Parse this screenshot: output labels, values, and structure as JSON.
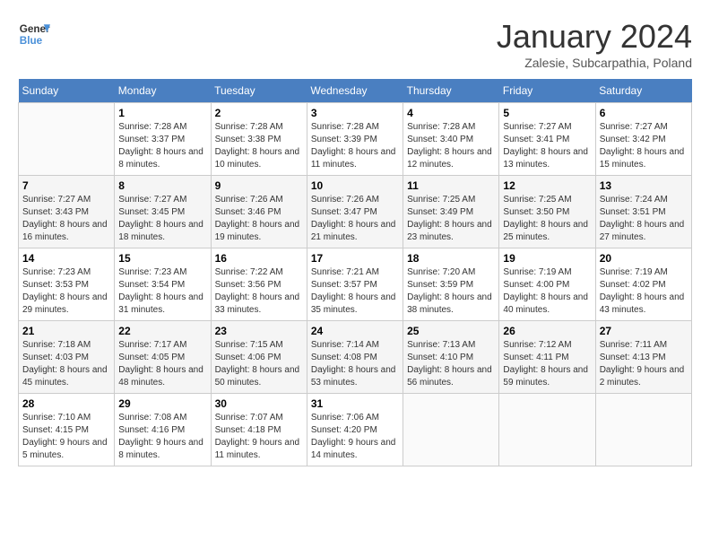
{
  "header": {
    "logo_line1": "General",
    "logo_line2": "Blue",
    "month": "January 2024",
    "location": "Zalesie, Subcarpathia, Poland"
  },
  "weekdays": [
    "Sunday",
    "Monday",
    "Tuesday",
    "Wednesday",
    "Thursday",
    "Friday",
    "Saturday"
  ],
  "weeks": [
    [
      {
        "num": "",
        "sunrise": "",
        "sunset": "",
        "daylight": ""
      },
      {
        "num": "1",
        "sunrise": "Sunrise: 7:28 AM",
        "sunset": "Sunset: 3:37 PM",
        "daylight": "Daylight: 8 hours and 8 minutes."
      },
      {
        "num": "2",
        "sunrise": "Sunrise: 7:28 AM",
        "sunset": "Sunset: 3:38 PM",
        "daylight": "Daylight: 8 hours and 10 minutes."
      },
      {
        "num": "3",
        "sunrise": "Sunrise: 7:28 AM",
        "sunset": "Sunset: 3:39 PM",
        "daylight": "Daylight: 8 hours and 11 minutes."
      },
      {
        "num": "4",
        "sunrise": "Sunrise: 7:28 AM",
        "sunset": "Sunset: 3:40 PM",
        "daylight": "Daylight: 8 hours and 12 minutes."
      },
      {
        "num": "5",
        "sunrise": "Sunrise: 7:27 AM",
        "sunset": "Sunset: 3:41 PM",
        "daylight": "Daylight: 8 hours and 13 minutes."
      },
      {
        "num": "6",
        "sunrise": "Sunrise: 7:27 AM",
        "sunset": "Sunset: 3:42 PM",
        "daylight": "Daylight: 8 hours and 15 minutes."
      }
    ],
    [
      {
        "num": "7",
        "sunrise": "Sunrise: 7:27 AM",
        "sunset": "Sunset: 3:43 PM",
        "daylight": "Daylight: 8 hours and 16 minutes."
      },
      {
        "num": "8",
        "sunrise": "Sunrise: 7:27 AM",
        "sunset": "Sunset: 3:45 PM",
        "daylight": "Daylight: 8 hours and 18 minutes."
      },
      {
        "num": "9",
        "sunrise": "Sunrise: 7:26 AM",
        "sunset": "Sunset: 3:46 PM",
        "daylight": "Daylight: 8 hours and 19 minutes."
      },
      {
        "num": "10",
        "sunrise": "Sunrise: 7:26 AM",
        "sunset": "Sunset: 3:47 PM",
        "daylight": "Daylight: 8 hours and 21 minutes."
      },
      {
        "num": "11",
        "sunrise": "Sunrise: 7:25 AM",
        "sunset": "Sunset: 3:49 PM",
        "daylight": "Daylight: 8 hours and 23 minutes."
      },
      {
        "num": "12",
        "sunrise": "Sunrise: 7:25 AM",
        "sunset": "Sunset: 3:50 PM",
        "daylight": "Daylight: 8 hours and 25 minutes."
      },
      {
        "num": "13",
        "sunrise": "Sunrise: 7:24 AM",
        "sunset": "Sunset: 3:51 PM",
        "daylight": "Daylight: 8 hours and 27 minutes."
      }
    ],
    [
      {
        "num": "14",
        "sunrise": "Sunrise: 7:23 AM",
        "sunset": "Sunset: 3:53 PM",
        "daylight": "Daylight: 8 hours and 29 minutes."
      },
      {
        "num": "15",
        "sunrise": "Sunrise: 7:23 AM",
        "sunset": "Sunset: 3:54 PM",
        "daylight": "Daylight: 8 hours and 31 minutes."
      },
      {
        "num": "16",
        "sunrise": "Sunrise: 7:22 AM",
        "sunset": "Sunset: 3:56 PM",
        "daylight": "Daylight: 8 hours and 33 minutes."
      },
      {
        "num": "17",
        "sunrise": "Sunrise: 7:21 AM",
        "sunset": "Sunset: 3:57 PM",
        "daylight": "Daylight: 8 hours and 35 minutes."
      },
      {
        "num": "18",
        "sunrise": "Sunrise: 7:20 AM",
        "sunset": "Sunset: 3:59 PM",
        "daylight": "Daylight: 8 hours and 38 minutes."
      },
      {
        "num": "19",
        "sunrise": "Sunrise: 7:19 AM",
        "sunset": "Sunset: 4:00 PM",
        "daylight": "Daylight: 8 hours and 40 minutes."
      },
      {
        "num": "20",
        "sunrise": "Sunrise: 7:19 AM",
        "sunset": "Sunset: 4:02 PM",
        "daylight": "Daylight: 8 hours and 43 minutes."
      }
    ],
    [
      {
        "num": "21",
        "sunrise": "Sunrise: 7:18 AM",
        "sunset": "Sunset: 4:03 PM",
        "daylight": "Daylight: 8 hours and 45 minutes."
      },
      {
        "num": "22",
        "sunrise": "Sunrise: 7:17 AM",
        "sunset": "Sunset: 4:05 PM",
        "daylight": "Daylight: 8 hours and 48 minutes."
      },
      {
        "num": "23",
        "sunrise": "Sunrise: 7:15 AM",
        "sunset": "Sunset: 4:06 PM",
        "daylight": "Daylight: 8 hours and 50 minutes."
      },
      {
        "num": "24",
        "sunrise": "Sunrise: 7:14 AM",
        "sunset": "Sunset: 4:08 PM",
        "daylight": "Daylight: 8 hours and 53 minutes."
      },
      {
        "num": "25",
        "sunrise": "Sunrise: 7:13 AM",
        "sunset": "Sunset: 4:10 PM",
        "daylight": "Daylight: 8 hours and 56 minutes."
      },
      {
        "num": "26",
        "sunrise": "Sunrise: 7:12 AM",
        "sunset": "Sunset: 4:11 PM",
        "daylight": "Daylight: 8 hours and 59 minutes."
      },
      {
        "num": "27",
        "sunrise": "Sunrise: 7:11 AM",
        "sunset": "Sunset: 4:13 PM",
        "daylight": "Daylight: 9 hours and 2 minutes."
      }
    ],
    [
      {
        "num": "28",
        "sunrise": "Sunrise: 7:10 AM",
        "sunset": "Sunset: 4:15 PM",
        "daylight": "Daylight: 9 hours and 5 minutes."
      },
      {
        "num": "29",
        "sunrise": "Sunrise: 7:08 AM",
        "sunset": "Sunset: 4:16 PM",
        "daylight": "Daylight: 9 hours and 8 minutes."
      },
      {
        "num": "30",
        "sunrise": "Sunrise: 7:07 AM",
        "sunset": "Sunset: 4:18 PM",
        "daylight": "Daylight: 9 hours and 11 minutes."
      },
      {
        "num": "31",
        "sunrise": "Sunrise: 7:06 AM",
        "sunset": "Sunset: 4:20 PM",
        "daylight": "Daylight: 9 hours and 14 minutes."
      },
      {
        "num": "",
        "sunrise": "",
        "sunset": "",
        "daylight": ""
      },
      {
        "num": "",
        "sunrise": "",
        "sunset": "",
        "daylight": ""
      },
      {
        "num": "",
        "sunrise": "",
        "sunset": "",
        "daylight": ""
      }
    ]
  ]
}
